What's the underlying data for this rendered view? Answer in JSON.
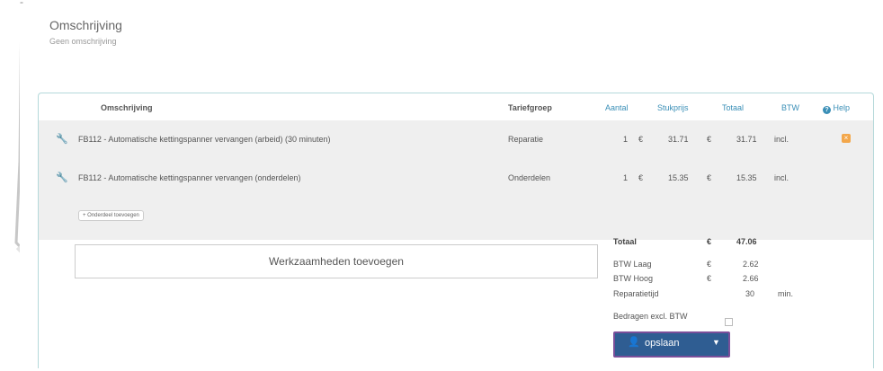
{
  "description": {
    "title": "Omschrijving",
    "subtitle": "Geen omschrijving"
  },
  "table": {
    "headers": {
      "omschrijving": "Omschrijving",
      "tariefgroep": "Tariefgroep",
      "aantal": "Aantal",
      "stukprijs": "Stukprijs",
      "totaal": "Totaal",
      "btw": "BTW",
      "help": "Help"
    },
    "rows": [
      {
        "omschrijving": "FB112 - Automatische kettingspanner vervangen (arbeid) (30 minuten)",
        "tariefgroep": "Reparatie",
        "aantal": "1",
        "cur1": "€",
        "stukprijs": "31.71",
        "cur2": "€",
        "totaal": "31.71",
        "btw": "incl."
      },
      {
        "omschrijving": "FB112 - Automatische kettingspanner vervangen (onderdelen)",
        "tariefgroep": "Onderdelen",
        "aantal": "1",
        "cur1": "€",
        "stukprijs": "15.35",
        "cur2": "€",
        "totaal": "15.35",
        "btw": "incl."
      }
    ],
    "add_item_label": "+ Onderdeel toevoegen"
  },
  "add_work_label": "Werkzaamheden toevoegen",
  "summary": {
    "totaal_label": "Totaal",
    "totaal_cur": "€",
    "totaal_value": "47.06",
    "btw_laag_label": "BTW Laag",
    "btw_laag_cur": "€",
    "btw_laag_value": "2.62",
    "btw_hoog_label": "BTW Hoog",
    "btw_hoog_cur": "€",
    "btw_hoog_value": "2.66",
    "reparatietijd_label": "Reparatietijd",
    "reparatietijd_value": "30",
    "reparatietijd_unit": "min.",
    "excl_btw_label": "Bedragen excl. BTW"
  },
  "save_button": {
    "label": "opslaan"
  },
  "colors": {
    "accent_blue": "#3a8fb7",
    "save_button": "#2f5d92",
    "delete_orange": "#f3a74b",
    "panel_border": "#b5d9da"
  },
  "icons": {
    "row_icon": "wrench-icon",
    "help": "question-circle-icon",
    "delete": "remove-icon",
    "save": "user-upload-icon",
    "dropdown": "caret-down-icon"
  }
}
